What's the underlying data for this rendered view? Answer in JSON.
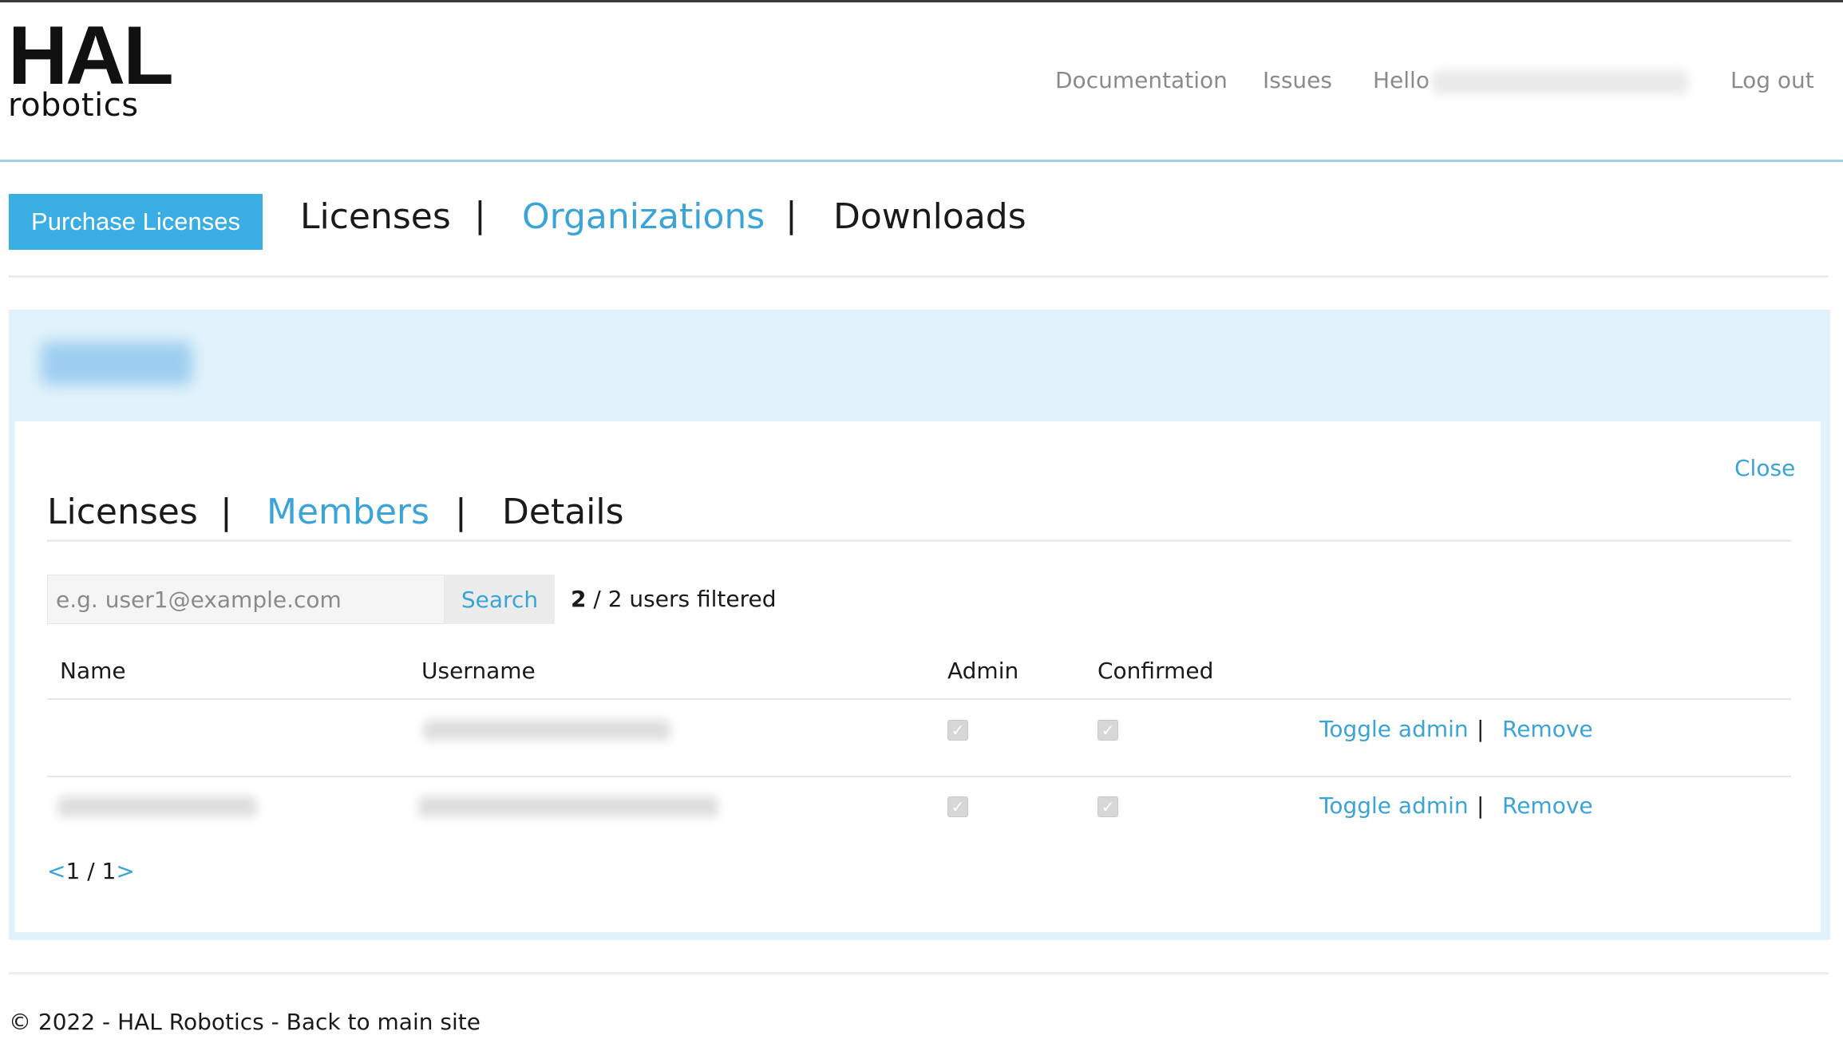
{
  "header": {
    "logo_top": "HAL",
    "logo_bottom": "robotics",
    "nav": {
      "documentation": "Documentation",
      "issues": "Issues",
      "hello": "Hello",
      "logout": "Log out"
    }
  },
  "main_tabs": {
    "purchase": "Purchase Licenses",
    "licenses": "Licenses",
    "organizations": "Organizations",
    "downloads": "Downloads",
    "separator": "|"
  },
  "org_panel": {
    "close": "Close",
    "sub_tabs": {
      "licenses": "Licenses",
      "members": "Members",
      "details": "Details",
      "separator": "|"
    },
    "search": {
      "placeholder": "e.g. user1@example.com",
      "button": "Search",
      "filtered_count": "2",
      "filtered_text": " / 2 users filtered"
    },
    "table": {
      "headers": [
        "Name",
        "Username",
        "Admin",
        "Confirmed"
      ],
      "rows": [
        {
          "admin_checked": true,
          "confirmed_checked": true,
          "toggle": "Toggle admin",
          "remove": "Remove"
        },
        {
          "admin_checked": true,
          "confirmed_checked": true,
          "toggle": "Toggle admin",
          "remove": "Remove"
        }
      ]
    },
    "pager": {
      "prev": "<",
      "current": "1",
      "separator": " / ",
      "total": "1",
      "next": ">"
    }
  },
  "footer": {
    "text": "© 2022 - HAL Robotics - Back to main site"
  },
  "colors": {
    "accent": "#3aa4d8",
    "button": "#3aaee3",
    "panel": "#e1f2fa"
  }
}
